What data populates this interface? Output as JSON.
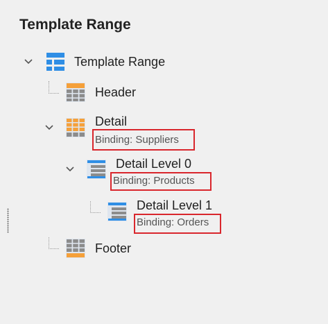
{
  "panel": {
    "title": "Template Range"
  },
  "tree": {
    "root": {
      "label": "Template Range",
      "icon": "template-range-icon"
    },
    "header": {
      "label": "Header",
      "icon": "grid-icon"
    },
    "detail": {
      "label": "Detail",
      "binding": "Binding: Suppliers",
      "icon": "orange-grid-icon"
    },
    "detail_level_0": {
      "label": "Detail Level 0",
      "binding": "Binding: Products",
      "icon": "detail-level-icon"
    },
    "detail_level_1": {
      "label": "Detail Level 1",
      "binding": "Binding: Orders",
      "icon": "detail-level-icon"
    },
    "footer": {
      "label": "Footer",
      "icon": "grid-icon"
    }
  },
  "colors": {
    "highlight_border": "#d9262c",
    "accent_blue": "#2f8ee5",
    "orange": "#f5a03a",
    "panel_bg": "#f0f0f0"
  }
}
